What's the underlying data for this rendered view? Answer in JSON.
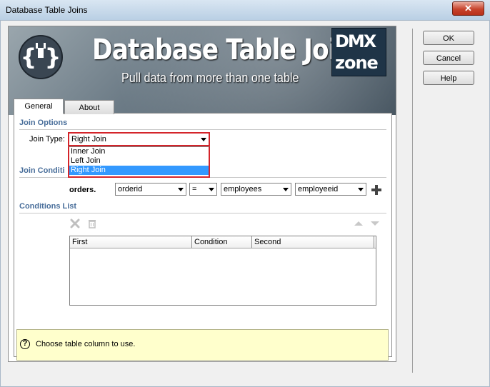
{
  "window": {
    "title": "Database Table Joins",
    "close_glyph": "✕"
  },
  "buttons": {
    "ok": "OK",
    "cancel": "Cancel",
    "help": "Help"
  },
  "banner": {
    "logo_glyph": "{ }",
    "title": "Database Table Joins",
    "subtitle": "Pull data from more than one table",
    "brand_top": "DMX",
    "brand_bottom": "zone"
  },
  "tabs": [
    {
      "label": "General",
      "active": true
    },
    {
      "label": "About",
      "active": false
    }
  ],
  "join_options": {
    "heading": "Join Options",
    "join_type_label": "Join Type:",
    "join_type_value": "Right Join",
    "options": [
      "Inner Join",
      "Left Join",
      "Right Join"
    ],
    "selected_index": 2
  },
  "join_condition": {
    "heading": "Join Conditi",
    "table_label": "orders.",
    "left_column": "orderid",
    "operator": "=",
    "right_table": "employees",
    "right_column": "employeeid"
  },
  "conditions_list": {
    "heading": "Conditions List",
    "columns": [
      "First",
      "Condition",
      "Second"
    ]
  },
  "hint": {
    "icon": "?",
    "text": "Choose table column to use."
  },
  "icons": {
    "delete": "x-icon",
    "trash": "trash-icon",
    "up": "arrow-up-icon",
    "down": "arrow-down-icon",
    "add": "plus-icon"
  },
  "colors": {
    "accent_red": "#d4242a",
    "heading_blue": "#4a6f9b",
    "selection_blue": "#3399ff",
    "hint_bg": "#ffffcc"
  }
}
